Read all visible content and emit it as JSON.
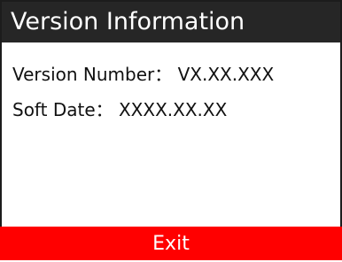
{
  "header": {
    "title": "Version Information"
  },
  "info": {
    "version_label": "Version Number",
    "version_value": "VX.XX.XXX",
    "date_label": "Soft Date",
    "date_value": "XXXX.XX.XX",
    "separator": "："
  },
  "footer": {
    "exit_label": "Exit"
  },
  "colors": {
    "header_bg": "#262626",
    "exit_bg": "#ff0000",
    "text": "#111111"
  }
}
